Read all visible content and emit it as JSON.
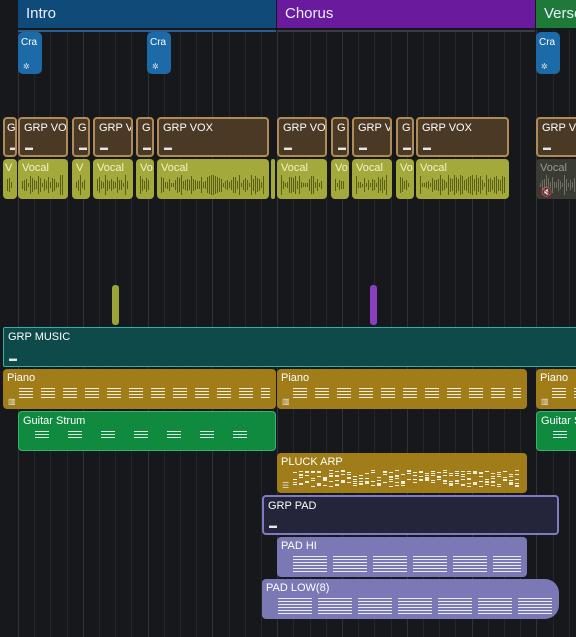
{
  "arrangement": {
    "regions": [
      {
        "id": "intro",
        "name": "Intro",
        "color": "#0f4a78"
      },
      {
        "id": "chorus",
        "name": "Chorus",
        "color": "#6a1a9c"
      },
      {
        "id": "verse",
        "name": "Verse",
        "color": "#1f7a3a"
      }
    ],
    "crash_label": "Cra",
    "grp_vox": {
      "label_full": "GRP VOX",
      "label_short1": "GRP VO",
      "label_short2": "GRP V",
      "label_single": "G"
    },
    "vocal": {
      "label_full": "Vocal",
      "label_short": "Vo",
      "label_single": "V"
    },
    "grp_music_label": "GRP MUSIC",
    "piano_label": "Piano",
    "guitar_label": "Guitar Strum",
    "pluck_label": "PLUCK ARP",
    "grp_pad_label": "GRP PAD",
    "pad_hi_label": "PAD HI",
    "pad_low_label": "PAD LOW(8)"
  },
  "colors": {
    "background": "#17181c",
    "vocal": "#a3a93a",
    "grp_vox": "#b08a57",
    "piano": "#a07d18",
    "guitar": "#0f8a3e",
    "pad": "#7a78b5",
    "grp_music": "#0f4a4a",
    "crash": "#1d6aa8"
  },
  "icons": {
    "group": "folder-icon",
    "crash": "gear-icon",
    "piano": "midi-icon",
    "mute": "speaker-muted-icon",
    "note_list": "lines-icon"
  }
}
